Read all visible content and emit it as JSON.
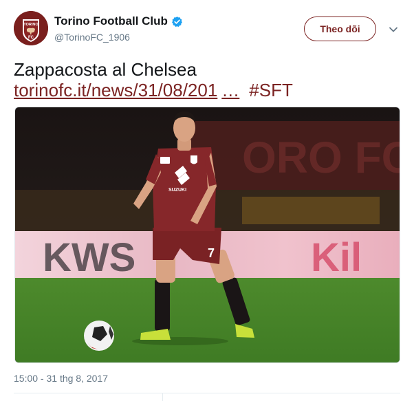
{
  "account": {
    "display_name": "Torino Football Club",
    "handle": "@TorinoFC_1906",
    "avatar_text": "TORINO",
    "avatar_letters": "FC"
  },
  "actions": {
    "follow_label": "Theo dõi"
  },
  "tweet": {
    "text_line1": "Zappacosta al Chelsea",
    "link_text": "torinofc.it/news/31/08/201",
    "ellipsis": "…",
    "hashtag": "#SFT"
  },
  "media": {
    "jersey_number": "7",
    "sponsor": "SUZUKI",
    "stand_text": "ORO FC",
    "ad_left": "KWS",
    "ad_right": "Kil"
  },
  "meta": {
    "timestamp": "15:00 - 31 thg 8, 2017"
  },
  "colors": {
    "brand": "#7b2322",
    "verified": "#1da1f2",
    "muted_text": "#657786"
  },
  "icons": {
    "verified": "verified-badge-icon",
    "caret": "chevron-down-icon"
  }
}
